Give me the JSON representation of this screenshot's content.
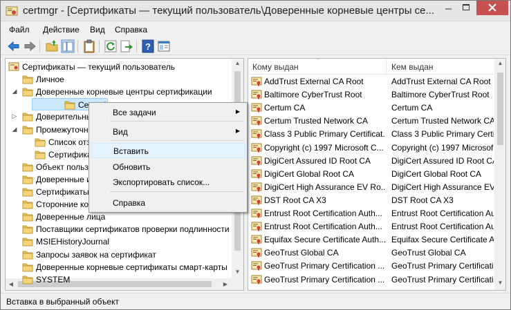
{
  "window": {
    "title": "certmgr - [Сертификаты — текущий пользователь\\Доверенные корневые центры се..."
  },
  "menubar": {
    "items": [
      "Файл",
      "Действие",
      "Вид",
      "Справка"
    ]
  },
  "toolbar": {
    "icons": [
      "back-arrow-icon",
      "forward-arrow-icon",
      "up-folder-icon",
      "show-hide-tree-icon",
      "clipboard-icon",
      "refresh-icon",
      "export-icon",
      "help-icon",
      "properties-icon"
    ]
  },
  "tree": {
    "items": [
      {
        "label": "Сертификаты — текущий пользователь",
        "level": 0,
        "expander": ""
      },
      {
        "label": "Личное",
        "level": 1,
        "expander": ""
      },
      {
        "label": "Доверенные корневые центры сертификации",
        "level": 1,
        "expander": "◢"
      },
      {
        "label": "Сертификаты",
        "level": 2,
        "expander": "",
        "selected": true
      },
      {
        "label": "Доверительные отношения в предприятии",
        "level": 1,
        "expander": "▷"
      },
      {
        "label": "Промежуточные центры сертификации",
        "level": 1,
        "expander": "◢"
      },
      {
        "label": "Список отзыва сертификатов",
        "level": 2,
        "expander": ""
      },
      {
        "label": "Сертификаты",
        "level": 2,
        "expander": ""
      },
      {
        "label": "Объект пользователя Active Directory",
        "level": 1,
        "expander": ""
      },
      {
        "label": "Доверенные издатели",
        "level": 1,
        "expander": ""
      },
      {
        "label": "Сертификаты, к которым нет доверия",
        "level": 1,
        "expander": ""
      },
      {
        "label": "Сторонние корневые центры сертификации",
        "level": 1,
        "expander": ""
      },
      {
        "label": "Доверенные лица",
        "level": 1,
        "expander": ""
      },
      {
        "label": "Поставщики сертификатов проверки подлинности",
        "level": 1,
        "expander": ""
      },
      {
        "label": "MSIEHistoryJournal",
        "level": 1,
        "expander": ""
      },
      {
        "label": "Запросы заявок на сертификат",
        "level": 1,
        "expander": ""
      },
      {
        "label": "Доверенные корневые сертификаты смарт-карты",
        "level": 1,
        "expander": ""
      },
      {
        "label": "SYSTEM",
        "level": 1,
        "expander": ""
      }
    ]
  },
  "list": {
    "columns": [
      "Кому выдан",
      "Кем выдан"
    ],
    "rows": [
      [
        "AddTrust External CA Root",
        "AddTrust External CA Root"
      ],
      [
        "Baltimore CyberTrust Root",
        "Baltimore CyberTrust Root"
      ],
      [
        "Certum CA",
        "Certum CA"
      ],
      [
        "Certum Trusted Network CA",
        "Certum Trusted Network CA"
      ],
      [
        "Class 3 Public Primary Certificat...",
        "Class 3 Public Primary Certificat"
      ],
      [
        "Copyright (c) 1997 Microsoft C...",
        "Copyright (c) 1997 Microsof"
      ],
      [
        "DigiCert Assured ID Root CA",
        "DigiCert Assured ID Root CA"
      ],
      [
        "DigiCert Global Root CA",
        "DigiCert Global Root CA"
      ],
      [
        "DigiCert High Assurance EV Ro...",
        "DigiCert High Assurance EV"
      ],
      [
        "DST Root CA X3",
        "DST Root CA X3"
      ],
      [
        "Entrust Root Certification Auth...",
        "Entrust Root Certification Au"
      ],
      [
        "Entrust Root Certification Auth...",
        "Entrust Root Certification Au"
      ],
      [
        "Equifax Secure Certificate Auth...",
        "Equifax Secure Certificate Au"
      ],
      [
        "GeoTrust Global CA",
        "GeoTrust Global CA"
      ],
      [
        "GeoTrust Primary Certification ...",
        "GeoTrust Primary Certification"
      ],
      [
        "GeoTrust Primary Certification ...",
        "GeoTrust Primary Certification"
      ]
    ]
  },
  "context_menu": {
    "items": [
      {
        "label": "Все задачи",
        "submenu": true
      },
      {
        "label": "Вид",
        "submenu": true
      },
      {
        "label": "Вставить",
        "highlighted": true
      },
      {
        "label": "Обновить"
      },
      {
        "label": "Экспортировать список..."
      },
      {
        "label": "Справка"
      }
    ]
  },
  "statusbar": {
    "text": "Вставка в выбранный объект"
  },
  "colors": {
    "selection": "#cce8ff",
    "folder": "#e8c15a",
    "close_button": "#c75050"
  }
}
